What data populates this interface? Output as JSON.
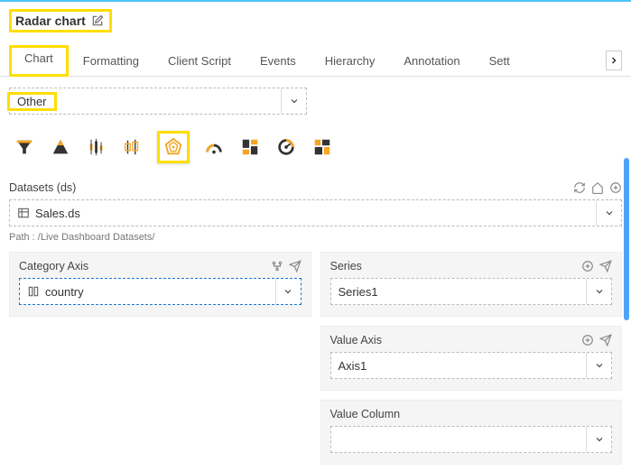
{
  "header": {
    "title": "Radar chart"
  },
  "tabs": {
    "items": [
      "Chart",
      "Formatting",
      "Client Script",
      "Events",
      "Hierarchy",
      "Annotation",
      "Sett"
    ],
    "active_index": 0
  },
  "type_selector": {
    "value": "Other"
  },
  "chart_icons": [
    "funnel-icon",
    "pyramid-icon",
    "candlestick-icon",
    "boxplot-icon",
    "radar-icon",
    "gauge-semi-icon",
    "treemap-icon",
    "gauge-full-icon",
    "tiles-icon"
  ],
  "datasets": {
    "label": "Datasets (ds)",
    "value": "Sales.ds",
    "path_label": "Path : /Live Dashboard Datasets/"
  },
  "category_axis": {
    "label": "Category Axis",
    "value": "country"
  },
  "series": {
    "label": "Series",
    "value": "Series1"
  },
  "value_axis": {
    "label": "Value Axis",
    "value": "Axis1"
  },
  "value_column": {
    "label": "Value Column",
    "value": ""
  }
}
